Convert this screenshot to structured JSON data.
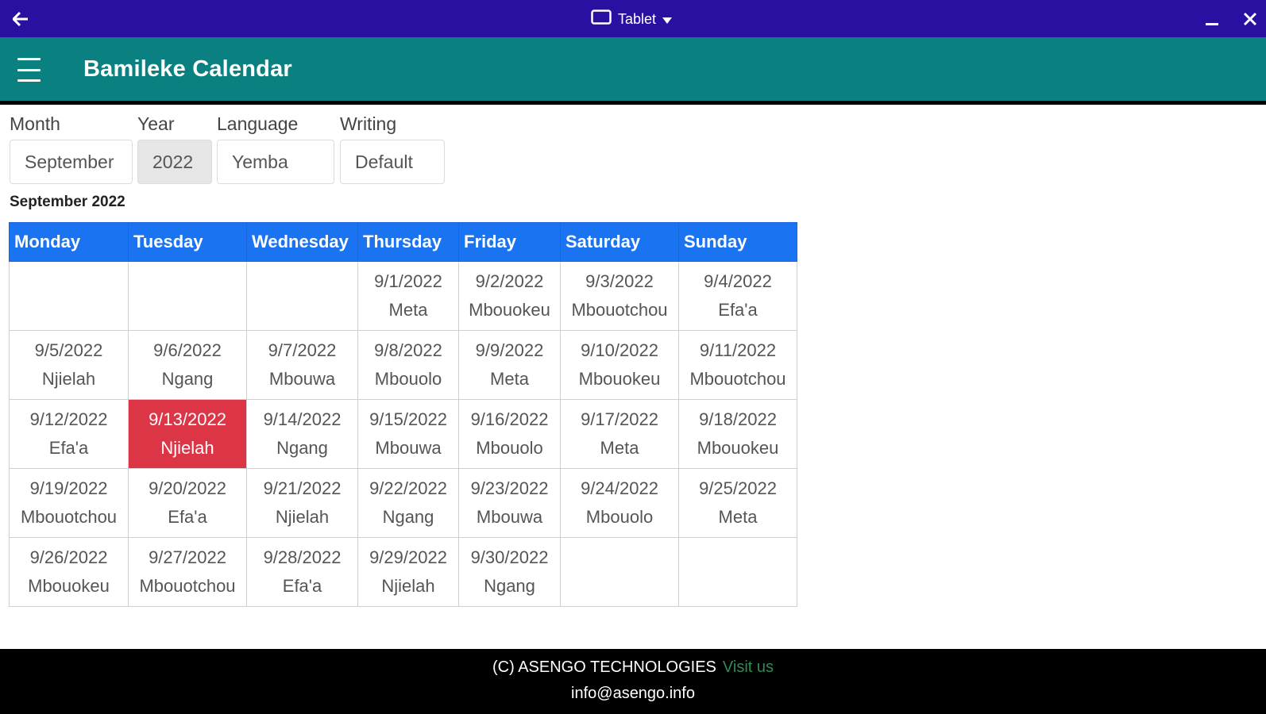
{
  "titlebar": {
    "device_label": "Tablet"
  },
  "appbar": {
    "title": "Bamileke Calendar"
  },
  "filters": {
    "month_label": "Month",
    "month_value": "September",
    "year_label": "Year",
    "year_value": "2022",
    "language_label": "Language",
    "language_value": "Yemba",
    "writing_label": "Writing",
    "writing_value": "Default"
  },
  "calendar": {
    "caption": "September 2022",
    "headers": [
      "Monday",
      "Tuesday",
      "Wednesday",
      "Thursday",
      "Friday",
      "Saturday",
      "Sunday"
    ],
    "rows": [
      [
        {
          "date": "",
          "name": ""
        },
        {
          "date": "",
          "name": ""
        },
        {
          "date": "",
          "name": ""
        },
        {
          "date": "9/1/2022",
          "name": "Meta"
        },
        {
          "date": "9/2/2022",
          "name": "Mbouokeu"
        },
        {
          "date": "9/3/2022",
          "name": "Mbouotchou"
        },
        {
          "date": "9/4/2022",
          "name": "Efa'a"
        }
      ],
      [
        {
          "date": "9/5/2022",
          "name": "Njielah"
        },
        {
          "date": "9/6/2022",
          "name": "Ngang"
        },
        {
          "date": "9/7/2022",
          "name": "Mbouwa"
        },
        {
          "date": "9/8/2022",
          "name": "Mbouolo"
        },
        {
          "date": "9/9/2022",
          "name": "Meta"
        },
        {
          "date": "9/10/2022",
          "name": "Mbouokeu"
        },
        {
          "date": "9/11/2022",
          "name": "Mbouotchou"
        }
      ],
      [
        {
          "date": "9/12/2022",
          "name": "Efa'a"
        },
        {
          "date": "9/13/2022",
          "name": "Njielah",
          "today": true
        },
        {
          "date": "9/14/2022",
          "name": "Ngang"
        },
        {
          "date": "9/15/2022",
          "name": "Mbouwa"
        },
        {
          "date": "9/16/2022",
          "name": "Mbouolo"
        },
        {
          "date": "9/17/2022",
          "name": "Meta"
        },
        {
          "date": "9/18/2022",
          "name": "Mbouokeu"
        }
      ],
      [
        {
          "date": "9/19/2022",
          "name": "Mbouotchou"
        },
        {
          "date": "9/20/2022",
          "name": "Efa'a"
        },
        {
          "date": "9/21/2022",
          "name": "Njielah"
        },
        {
          "date": "9/22/2022",
          "name": "Ngang"
        },
        {
          "date": "9/23/2022",
          "name": "Mbouwa"
        },
        {
          "date": "9/24/2022",
          "name": "Mbouolo"
        },
        {
          "date": "9/25/2022",
          "name": "Meta"
        }
      ],
      [
        {
          "date": "9/26/2022",
          "name": "Mbouokeu"
        },
        {
          "date": "9/27/2022",
          "name": "Mbouotchou"
        },
        {
          "date": "9/28/2022",
          "name": "Efa'a"
        },
        {
          "date": "9/29/2022",
          "name": "Njielah"
        },
        {
          "date": "9/30/2022",
          "name": "Ngang"
        },
        {
          "date": "",
          "name": ""
        },
        {
          "date": "",
          "name": ""
        }
      ]
    ]
  },
  "footer": {
    "copyright": "(C) ASENGO TECHNOLOGIES",
    "visit_link": "Visit us",
    "email": "info@asengo.info"
  },
  "colors": {
    "titlebar_bg": "#2b0fa0",
    "appbar_bg": "#0a8080",
    "header_bg": "#1a73f0",
    "today_bg": "#dc3545",
    "footer_bg": "#000000",
    "link": "#2e8b57"
  }
}
